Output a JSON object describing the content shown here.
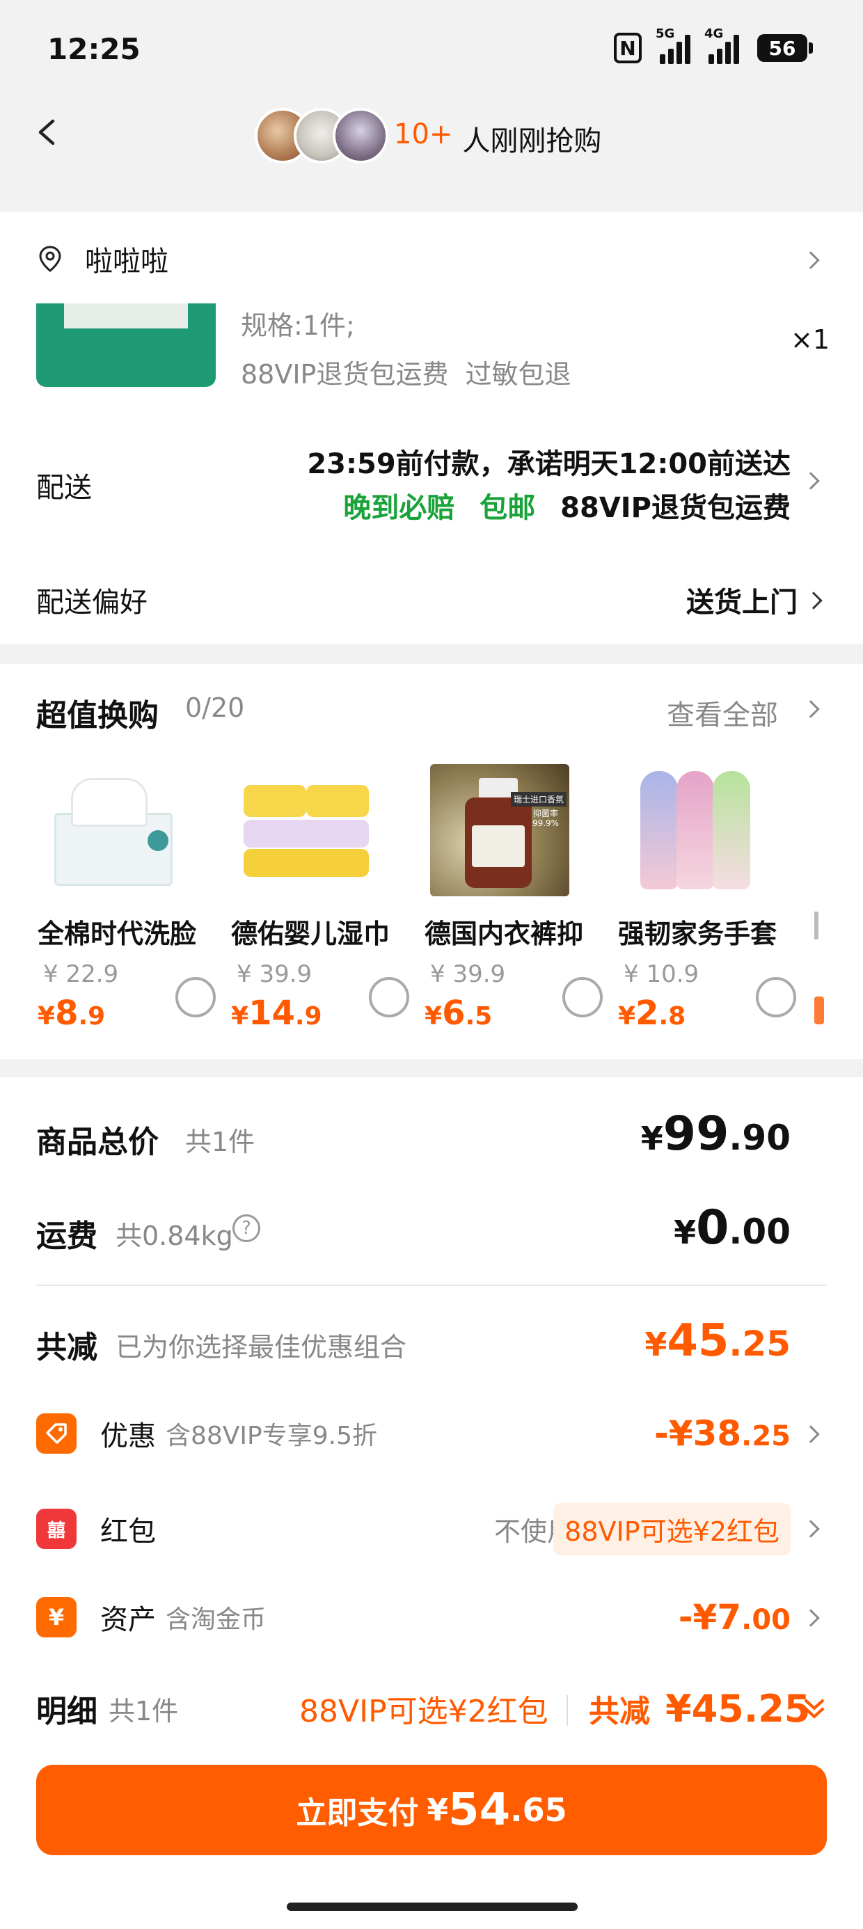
{
  "status": {
    "time": "12:25",
    "nfc": "N",
    "net1": "5G",
    "net2": "4G",
    "battery": "56"
  },
  "header": {
    "buyers_count": "10+",
    "buyers_text": "人刚刚抢购"
  },
  "address": {
    "name": "啦啦啦"
  },
  "product": {
    "spec": "规格:1件;",
    "service": "88VIP退货包运费  过敏包退",
    "qty": "×1"
  },
  "delivery": {
    "label": "配送",
    "line1": "23:59前付款，承诺明天12:00前送达",
    "tag1": "晚到必赔",
    "tag2": "包邮",
    "tag3": "88VIP退货包运费"
  },
  "pref": {
    "label": "配送偏好",
    "value": "送货上门"
  },
  "exchange": {
    "title": "超值换购",
    "count": "0/20",
    "see_all": "查看全部",
    "items": [
      {
        "name": "全棉时代洗脸",
        "old": "¥ 22.9",
        "cur": "¥",
        "int": "8",
        "dec": ".9"
      },
      {
        "name": "德佑婴儿湿巾",
        "old": "¥ 39.9",
        "cur": "¥",
        "int": "14",
        "dec": ".9"
      },
      {
        "name": "德国内衣裤抑",
        "old": "¥ 39.9",
        "cur": "¥",
        "int": "6",
        "dec": ".5"
      },
      {
        "name": "强韧家务手套",
        "old": "¥ 10.9",
        "cur": "¥",
        "int": "2",
        "dec": ".8"
      }
    ],
    "product3_badge": "瑞士进口香氛",
    "product3_badge2": "抑菌率 99.9%"
  },
  "summary": {
    "total_label": "商品总价",
    "total_sub": "共1件",
    "total_int": "99",
    "total_dec": ".90",
    "ship_label": "运费",
    "ship_sub": "共0.84kg",
    "ship_help": "?",
    "ship_int": "0",
    "ship_dec": ".00",
    "cur": "¥",
    "reduce_label": "共减",
    "reduce_sub": "已为你选择最佳优惠组合",
    "reduce_int": "45",
    "reduce_dec": ".25",
    "discount_label": "优惠",
    "discount_sub": "含88VIP专享9.5折",
    "discount_val_int": "-¥38",
    "discount_val_dec": ".25",
    "hongbao_label": "红包",
    "hongbao_status": "不使用",
    "hongbao_pill": "88VIP可选¥2红包",
    "asset_label": "资产",
    "asset_sub": "含淘金币",
    "asset_val_int": "-¥7",
    "asset_val_dec": ".00",
    "hongbao_icon": "囍",
    "asset_icon": "¥"
  },
  "footer": {
    "detail_label": "明细",
    "detail_sub": "共1件",
    "promo": "88VIP可选¥2红包",
    "reduce_label": "共减",
    "reduce_value": "¥45.25",
    "pay_label": "立即支付",
    "pay_cur": "¥",
    "pay_int": "54",
    "pay_dec": ".65"
  },
  "colors": {
    "accent": "#ff5a00",
    "green": "#1aa33a",
    "icon_red": "#f0383a",
    "icon_orange": "#ff6a00"
  }
}
